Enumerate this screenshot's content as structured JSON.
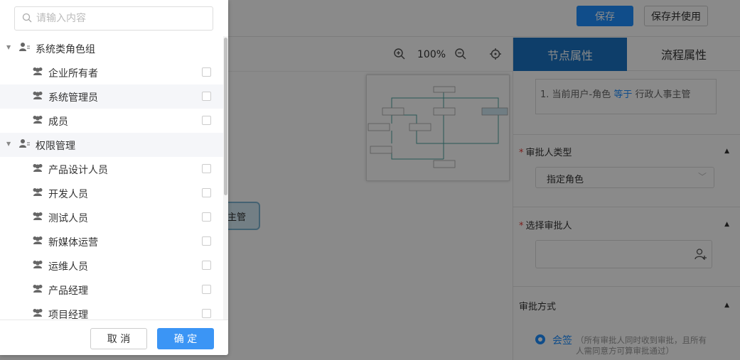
{
  "topbar": {
    "save_label": "保存",
    "save_use_label": "保存并使用"
  },
  "canvas": {
    "zoom": "100%",
    "node_text": "主管"
  },
  "panel": {
    "tabs": [
      {
        "label": "节点属性",
        "active": true
      },
      {
        "label": "流程属性",
        "active": false
      }
    ],
    "condition": {
      "prefix": "1. 当前用户-角色 ",
      "operator": "等于",
      "value": " 行政人事主管"
    },
    "approver_type": {
      "label": "审批人类型",
      "value": "指定角色"
    },
    "approver_select": {
      "label": "选择审批人"
    },
    "approval_method": {
      "label": "审批方式",
      "option": "会签",
      "desc": "（所有审批人同时收到审批，且所有人需同意方可算审批通过）"
    }
  },
  "popup": {
    "search_placeholder": "请输入内容",
    "groups": [
      {
        "label": "系统类角色组",
        "items": [
          "企业所有者",
          "系统管理员",
          "成员"
        ]
      },
      {
        "label": "权限管理",
        "items": [
          "产品设计人员",
          "开发人员",
          "测试人员",
          "新媒体运营",
          "运维人员",
          "产品经理",
          "项目经理"
        ]
      }
    ],
    "cancel_label": "取 消",
    "ok_label": "确 定"
  },
  "colors": {
    "primary": "#1e8fff",
    "tab_active": "#1a74c4",
    "required": "#e53935"
  }
}
